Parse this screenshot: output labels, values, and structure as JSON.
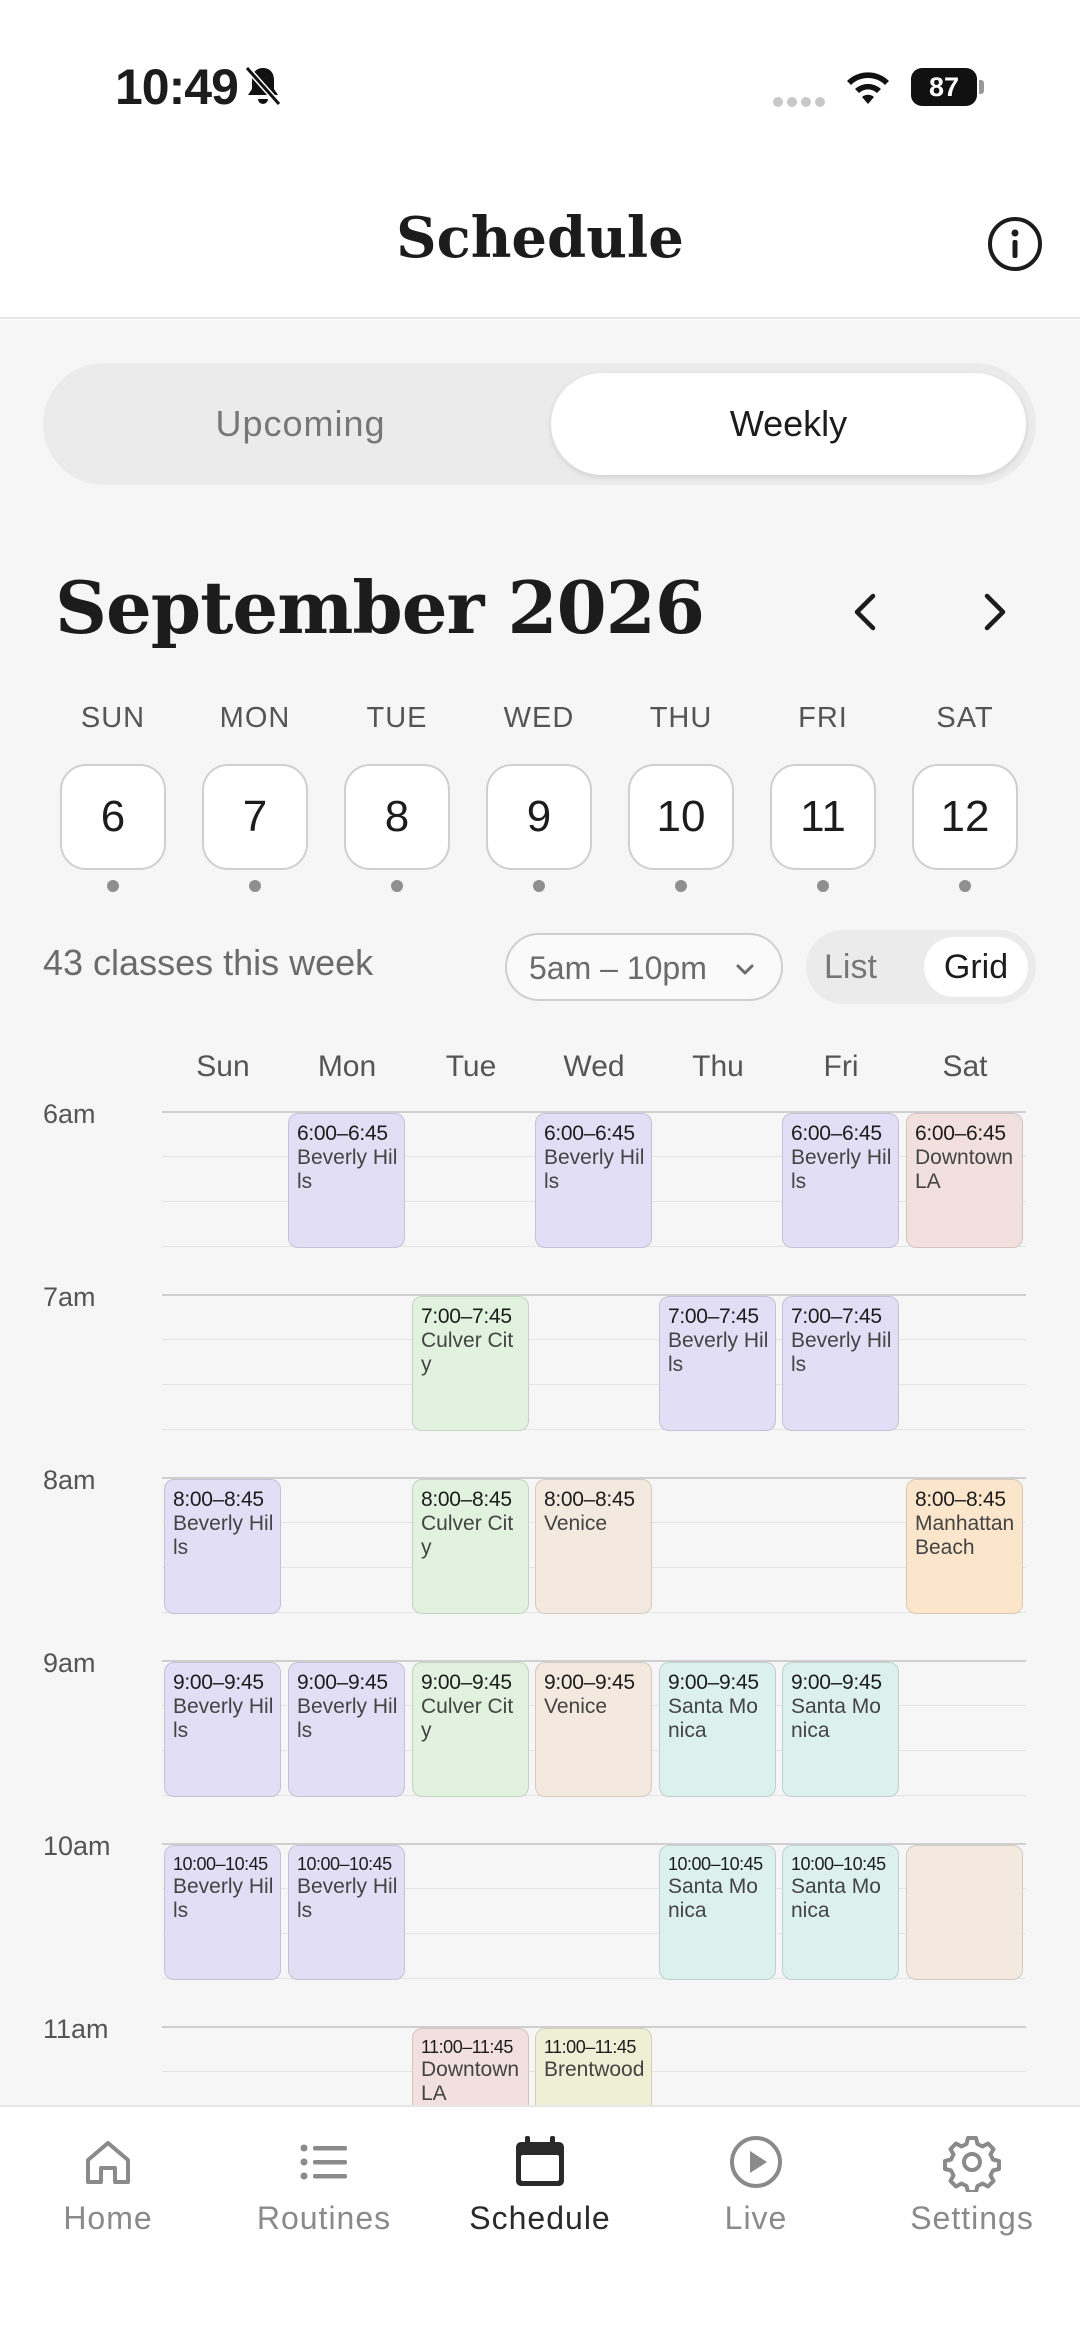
{
  "status_bar": {
    "time": "10:49",
    "battery": "87"
  },
  "header": {
    "title": "Schedule"
  },
  "segment": {
    "upcoming": "Upcoming",
    "weekly": "Weekly"
  },
  "calendar": {
    "month": "September 2026",
    "days": [
      {
        "name": "SUN",
        "date": "6"
      },
      {
        "name": "MON",
        "date": "7"
      },
      {
        "name": "TUE",
        "date": "8"
      },
      {
        "name": "WED",
        "date": "9"
      },
      {
        "name": "THU",
        "date": "10"
      },
      {
        "name": "FRI",
        "date": "11"
      },
      {
        "name": "SAT",
        "date": "12"
      }
    ]
  },
  "filters": {
    "count": "43 classes this week",
    "range": "5am – 10pm",
    "view_list": "List",
    "view_grid": "Grid"
  },
  "grid": {
    "columns": [
      "Sun",
      "Mon",
      "Tue",
      "Wed",
      "Thu",
      "Fri",
      "Sat"
    ],
    "hours": [
      "6am",
      "7am",
      "8am",
      "9am",
      "10am",
      "11am"
    ],
    "location_colors": {
      "Beverly Hills": "#e2def5",
      "Downtown LA": "#f2e0df",
      "Culver City": "#e1f2df",
      "Venice": "#f3e9df",
      "Manhattan Beach": "#fce6cb",
      "Santa Monica": "#dcf0ee",
      "Brentwood": "#edf0d4"
    },
    "events": [
      {
        "day": 1,
        "hour": 0,
        "time": "6:00–6:45",
        "location": "Beverly Hills",
        "color": "#e2def5"
      },
      {
        "day": 3,
        "hour": 0,
        "time": "6:00–6:45",
        "location": "Beverly Hills",
        "color": "#e2def5"
      },
      {
        "day": 5,
        "hour": 0,
        "time": "6:00–6:45",
        "location": "Beverly Hills",
        "color": "#e2def5"
      },
      {
        "day": 6,
        "hour": 0,
        "time": "6:00–6:45",
        "location": "Downtown LA",
        "color": "#f2e0df"
      },
      {
        "day": 2,
        "hour": 1,
        "time": "7:00–7:45",
        "location": "Culver City",
        "color": "#e1f2df"
      },
      {
        "day": 4,
        "hour": 1,
        "time": "7:00–7:45",
        "location": "Beverly Hills",
        "color": "#e2def5"
      },
      {
        "day": 5,
        "hour": 1,
        "time": "7:00–7:45",
        "location": "Beverly Hills",
        "color": "#e2def5"
      },
      {
        "day": 0,
        "hour": 2,
        "time": "8:00–8:45",
        "location": "Beverly Hills",
        "color": "#e2def5"
      },
      {
        "day": 2,
        "hour": 2,
        "time": "8:00–8:45",
        "location": "Culver City",
        "color": "#e1f2df"
      },
      {
        "day": 3,
        "hour": 2,
        "time": "8:00–8:45",
        "location": "Venice",
        "color": "#f3e9df"
      },
      {
        "day": 6,
        "hour": 2,
        "time": "8:00–8:45",
        "location": "Manhattan Beach",
        "color": "#fce6cb"
      },
      {
        "day": 0,
        "hour": 3,
        "time": "9:00–9:45",
        "location": "Beverly Hills",
        "color": "#e2def5"
      },
      {
        "day": 1,
        "hour": 3,
        "time": "9:00–9:45",
        "location": "Beverly Hills",
        "color": "#e2def5"
      },
      {
        "day": 2,
        "hour": 3,
        "time": "9:00–9:45",
        "location": "Culver City",
        "color": "#e1f2df"
      },
      {
        "day": 3,
        "hour": 3,
        "time": "9:00–9:45",
        "location": "Venice",
        "color": "#f3e9df"
      },
      {
        "day": 4,
        "hour": 3,
        "time": "9:00–9:45",
        "location": "Santa Monica",
        "color": "#dcf0ee"
      },
      {
        "day": 5,
        "hour": 3,
        "time": "9:00–9:45",
        "location": "Santa Monica",
        "color": "#dcf0ee"
      },
      {
        "day": 0,
        "hour": 4,
        "time": "10:00–10:45",
        "location": "Beverly Hills",
        "color": "#e2def5"
      },
      {
        "day": 1,
        "hour": 4,
        "time": "10:00–10:45",
        "location": "Beverly Hills",
        "color": "#e2def5"
      },
      {
        "day": 4,
        "hour": 4,
        "time": "10:00–10:45",
        "location": "Santa Monica",
        "color": "#dcf0ee"
      },
      {
        "day": 5,
        "hour": 4,
        "time": "10:00–10:45",
        "location": "Santa Monica",
        "color": "#dcf0ee"
      },
      {
        "day": 6,
        "hour": 4,
        "time": "",
        "location": "",
        "color": "#f3e9df"
      },
      {
        "day": 2,
        "hour": 5,
        "time": "11:00–11:45",
        "location": "Downtown LA",
        "color": "#f2e0df"
      },
      {
        "day": 3,
        "hour": 5,
        "time": "11:00–11:45",
        "location": "Brentwood",
        "color": "#edf0d4"
      }
    ]
  },
  "fab": {
    "icon": "plus-icon"
  },
  "tabs": [
    {
      "label": "Home",
      "icon": "home-icon"
    },
    {
      "label": "Routines",
      "icon": "list-icon"
    },
    {
      "label": "Schedule",
      "icon": "calendar-icon",
      "active": true
    },
    {
      "label": "Live",
      "icon": "play-circle-icon"
    },
    {
      "label": "Settings",
      "icon": "gear-icon"
    }
  ]
}
